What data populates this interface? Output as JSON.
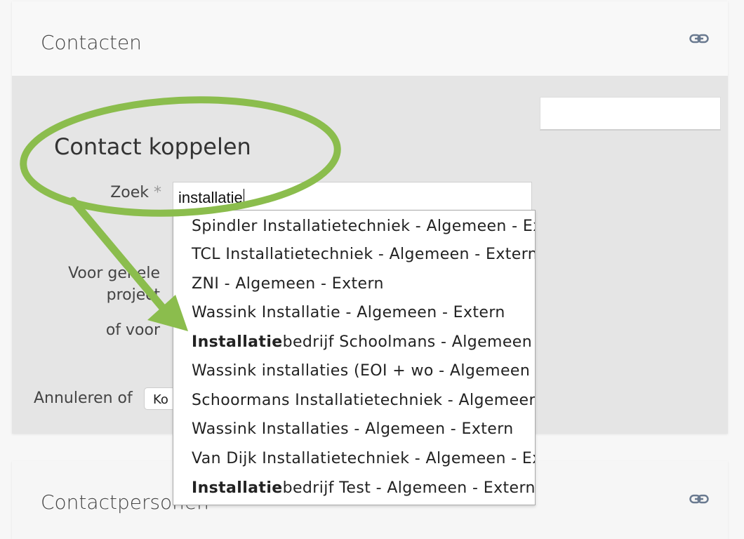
{
  "contacten_panel": {
    "title": "Contacten",
    "link_icon": "link-icon"
  },
  "form": {
    "title": "Contact koppelen",
    "zoek_label": "Zoek",
    "required_marker": "*",
    "search_value": "installatie",
    "gehele_label_line1": "Voor gehele",
    "gehele_label_line2": "project",
    "voor_label": "of voor",
    "cancel_text": "Annuleren of",
    "koppel_button": "Ko"
  },
  "dropdown": {
    "items": [
      {
        "bold": "",
        "rest": "Spindler Installatietechniek - Algemeen - Extern"
      },
      {
        "bold": "",
        "rest": "TCL Installatietechniek - Algemeen - Extern"
      },
      {
        "bold": "",
        "rest": "ZNI - Algemeen - Extern"
      },
      {
        "bold": "",
        "rest": "Wassink Installatie - Algemeen - Extern"
      },
      {
        "bold": "Installatie",
        "rest": "bedrijf Schoolmans - Algemeen - Extern"
      },
      {
        "bold": "",
        "rest": "Wassink installaties (EOI + wo - Algemeen - Extern"
      },
      {
        "bold": "",
        "rest": "Schoormans Installatietechniek - Algemeen - Extern"
      },
      {
        "bold": "",
        "rest": "Wassink Installaties - Algemeen - Extern"
      },
      {
        "bold": "",
        "rest": "Van Dijk Installatietechniek - Algemeen - Extern"
      },
      {
        "bold": "Installatie",
        "rest": "bedrijf Test - Algemeen - Extern"
      }
    ]
  },
  "contactpersonen_panel": {
    "title": "Contactpersonen",
    "link_icon": "link-icon"
  },
  "colors": {
    "annotation_green": "#8bbd4d",
    "panel_bg": "#e5e5e5",
    "header_bg": "#f8f8f8"
  }
}
